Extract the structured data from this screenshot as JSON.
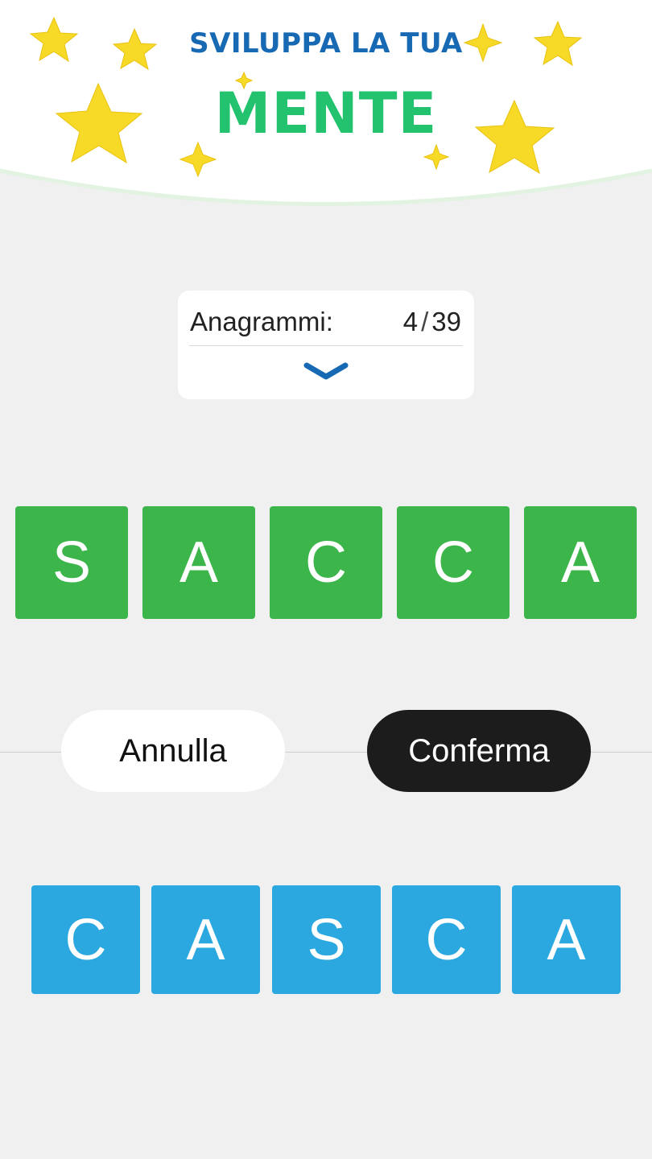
{
  "banner": {
    "line1": "SVILUPPA LA TUA",
    "line2": "MENTE",
    "colors": {
      "line1": "#1769b3",
      "line2": "#22c26e",
      "stars": "#f7d927"
    }
  },
  "counter": {
    "label": "Anagrammi:",
    "found": "4",
    "separator": "/",
    "total": "39",
    "expand_icon": "chevron-down-icon"
  },
  "target_word": {
    "color": "#3cb54a",
    "letters": [
      "S",
      "A",
      "C",
      "C",
      "A"
    ]
  },
  "actions": {
    "cancel_label": "Annulla",
    "confirm_label": "Conferma"
  },
  "available_letters": {
    "color": "#2ba8e0",
    "letters": [
      "C",
      "A",
      "S",
      "C",
      "A"
    ]
  }
}
